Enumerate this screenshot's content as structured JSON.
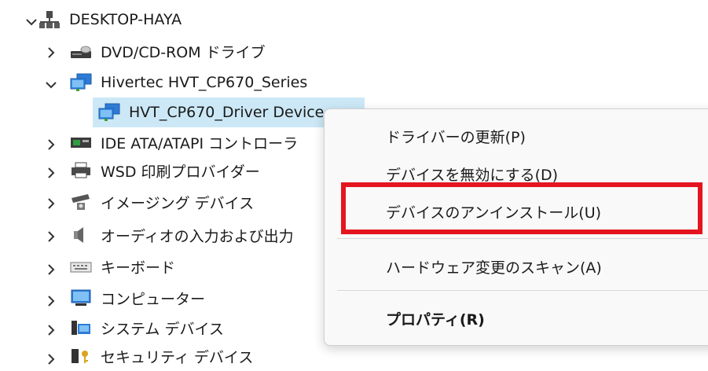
{
  "tree": {
    "root": {
      "label": "DESKTOP-HAYA",
      "icon": "computer-network-icon"
    },
    "items": [
      {
        "label": "DVD/CD-ROM ドライブ",
        "icon": "dvd-drive-icon"
      },
      {
        "label": "Hivertec HVT_CP670_Series",
        "icon": "network-monitor-icon"
      },
      {
        "label": "HVT_CP670_Driver Device",
        "icon": "network-monitor-icon"
      },
      {
        "label": "IDE ATA/ATAPI コントローラ",
        "icon": "ide-controller-icon"
      },
      {
        "label": "WSD 印刷プロバイダー",
        "icon": "printer-icon"
      },
      {
        "label": "イメージング デバイス",
        "icon": "camera-icon"
      },
      {
        "label": "オーディオの入力および出力",
        "icon": "speaker-icon"
      },
      {
        "label": "キーボード",
        "icon": "keyboard-icon"
      },
      {
        "label": "コンピューター",
        "icon": "monitor-icon"
      },
      {
        "label": "システム デバイス",
        "icon": "system-folder-icon"
      },
      {
        "label": "セキュリティ デバイス",
        "icon": "security-key-icon"
      }
    ]
  },
  "context_menu": {
    "items": [
      {
        "label": "ドライバーの更新(P)"
      },
      {
        "label": "デバイスを無効にする(D)"
      },
      {
        "label": "デバイスのアンインストール(U)"
      },
      {
        "label": "ハードウェア変更のスキャン(A)"
      },
      {
        "label": "プロパティ(R)"
      }
    ]
  },
  "colors": {
    "selection": "#cce8f6",
    "highlight_border": "#e4151f",
    "menu_background": "#f9f9f9"
  }
}
